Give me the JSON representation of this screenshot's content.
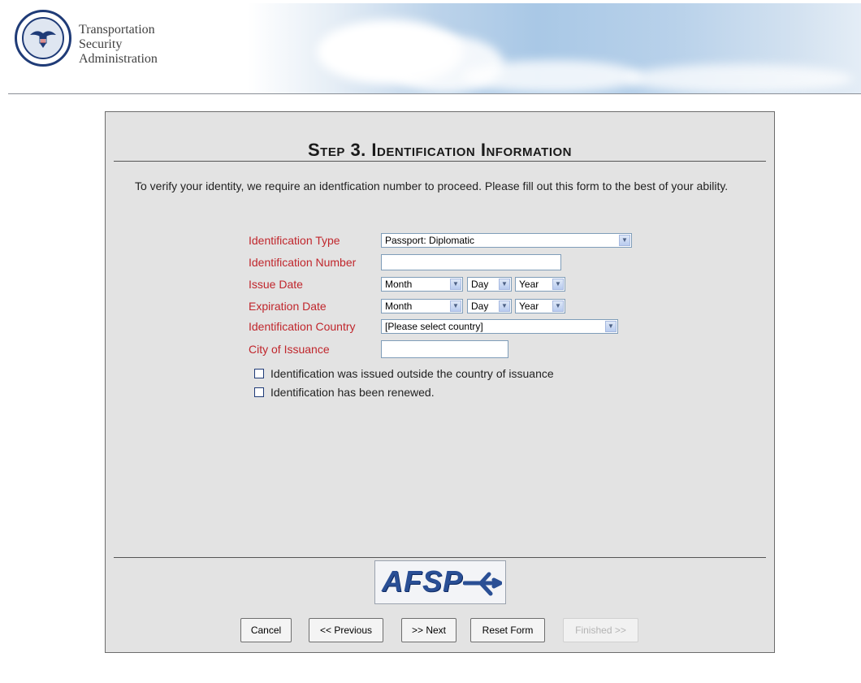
{
  "header": {
    "agency_lines": [
      "Transportation",
      "Security",
      "Administration"
    ]
  },
  "form": {
    "title": "Step 3. Identification Information",
    "intro": "To verify your identity, we require an identfication number to proceed. Please fill out this form to the best of your ability.",
    "fields": {
      "id_type": {
        "label": "Identification Type",
        "value": "Passport: Diplomatic"
      },
      "id_number": {
        "label": "Identification Number",
        "value": ""
      },
      "issue_date": {
        "label": "Issue Date",
        "month": "Month",
        "day": "Day",
        "year": "Year"
      },
      "expiration_date": {
        "label": "Expiration Date",
        "month": "Month",
        "day": "Day",
        "year": "Year"
      },
      "id_country": {
        "label": "Identification Country",
        "value": "[Please select country]"
      },
      "city": {
        "label": "City of Issuance",
        "value": ""
      }
    },
    "checkboxes": {
      "outside": {
        "label": "Identification was issued outside the country of issuance",
        "checked": false
      },
      "renewed": {
        "label": "Identification has been renewed.",
        "checked": false
      }
    },
    "logo_text": "AFSP",
    "buttons": {
      "cancel": "Cancel",
      "previous": "<< Previous",
      "next": ">> Next",
      "reset": "Reset Form",
      "finished": "Finished >>"
    }
  },
  "colors": {
    "label_red": "#c0262c",
    "panel_bg": "#e3e3e3",
    "logo_blue": "#2a4f95"
  }
}
